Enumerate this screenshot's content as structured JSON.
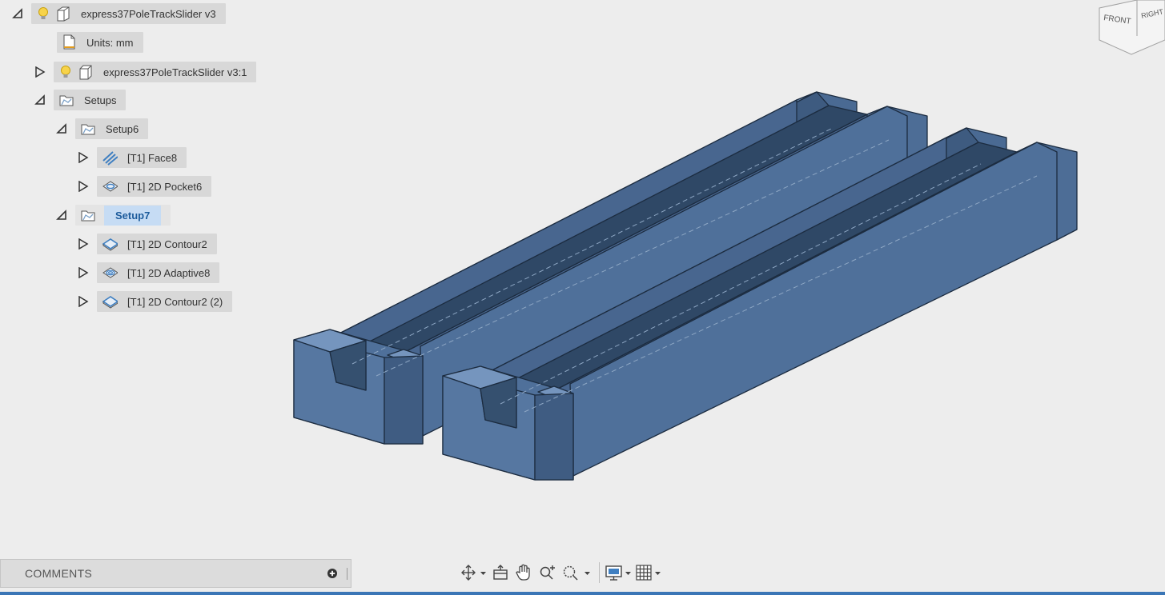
{
  "browser": {
    "root": {
      "label": "express37PoleTrackSlider v3",
      "icon": "component-icon"
    },
    "units": {
      "label": "Units: mm",
      "icon": "document-icon"
    },
    "body": {
      "label": "express37PoleTrackSlider v3:1",
      "icon": "body-icon"
    },
    "setups": {
      "label": "Setups",
      "icon": "setup-folder-icon"
    },
    "setup6": {
      "label": "Setup6",
      "icon": "setup-folder-icon"
    },
    "op_face8": {
      "label": "[T1] Face8",
      "icon": "face-op-icon"
    },
    "op_pocket6": {
      "label": "[T1] 2D Pocket6",
      "icon": "pocket-op-icon"
    },
    "setup7": {
      "label": "Setup7",
      "icon": "setup-folder-icon"
    },
    "op_contour2": {
      "label": "[T1] 2D Contour2",
      "icon": "contour-op-icon"
    },
    "op_adaptive8": {
      "label": "[T1] 2D Adaptive8",
      "icon": "adaptive-op-icon"
    },
    "op_contour2b": {
      "label": "[T1] 2D Contour2 (2)",
      "icon": "contour-op-icon"
    }
  },
  "viewcube": {
    "front": "FRONT",
    "right": "RIGHT"
  },
  "comments": {
    "label": "COMMENTS"
  },
  "navbar": {
    "tools": [
      "orbit-icon",
      "look-at-icon",
      "pan-icon",
      "zoom-icon",
      "zoom-window-icon",
      "display-settings-icon",
      "grid-icon"
    ]
  },
  "colors": {
    "part_fill": "#4f6f98",
    "part_edge": "#1c2c40",
    "background": "#ededed",
    "selected": "#c6dcf4",
    "accent": "#3b76b6"
  }
}
